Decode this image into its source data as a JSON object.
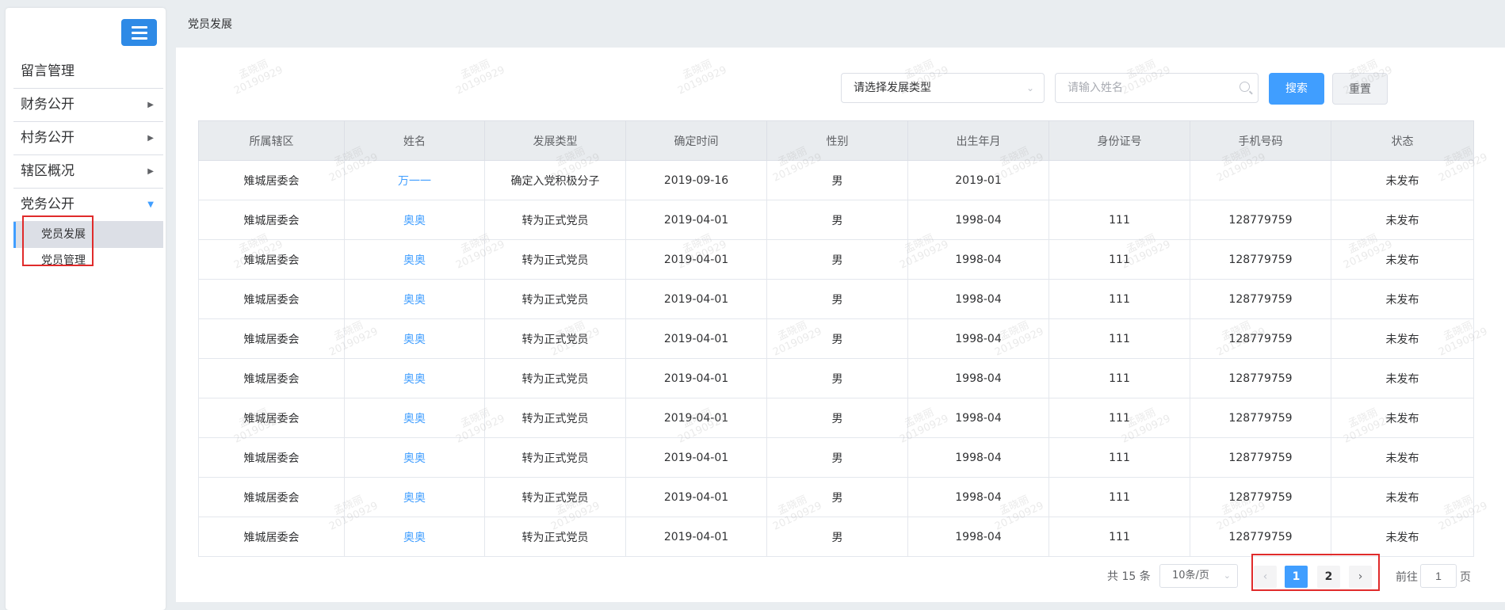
{
  "sidebar": {
    "menu": [
      {
        "label": "留言管理",
        "arrow": ""
      },
      {
        "label": "财务公开",
        "arrow": "▶"
      },
      {
        "label": "村务公开",
        "arrow": "▶"
      },
      {
        "label": "辖区概况",
        "arrow": "▶"
      },
      {
        "label": "党务公开",
        "arrow": "▼"
      }
    ],
    "submenu": [
      {
        "label": "党员发展"
      },
      {
        "label": "党员管理"
      }
    ]
  },
  "breadcrumb": "党员发展",
  "filters": {
    "type_select": "请选择发展类型",
    "name_placeholder": "请输入姓名",
    "search_label": "搜索",
    "reset_label": "重置"
  },
  "table": {
    "headers": [
      "所属辖区",
      "姓名",
      "发展类型",
      "确定时间",
      "性别",
      "出生年月",
      "身份证号",
      "手机号码",
      "状态"
    ],
    "rows": [
      [
        "雉城居委会",
        "万一一",
        "确定入党积极分子",
        "2019-09-16",
        "男",
        "2019-01",
        "",
        "",
        "未发布"
      ],
      [
        "雉城居委会",
        "奥奥",
        "转为正式党员",
        "2019-04-01",
        "男",
        "1998-04",
        "111",
        "128779759",
        "未发布"
      ],
      [
        "雉城居委会",
        "奥奥",
        "转为正式党员",
        "2019-04-01",
        "男",
        "1998-04",
        "111",
        "128779759",
        "未发布"
      ],
      [
        "雉城居委会",
        "奥奥",
        "转为正式党员",
        "2019-04-01",
        "男",
        "1998-04",
        "111",
        "128779759",
        "未发布"
      ],
      [
        "雉城居委会",
        "奥奥",
        "转为正式党员",
        "2019-04-01",
        "男",
        "1998-04",
        "111",
        "128779759",
        "未发布"
      ],
      [
        "雉城居委会",
        "奥奥",
        "转为正式党员",
        "2019-04-01",
        "男",
        "1998-04",
        "111",
        "128779759",
        "未发布"
      ],
      [
        "雉城居委会",
        "奥奥",
        "转为正式党员",
        "2019-04-01",
        "男",
        "1998-04",
        "111",
        "128779759",
        "未发布"
      ],
      [
        "雉城居委会",
        "奥奥",
        "转为正式党员",
        "2019-04-01",
        "男",
        "1998-04",
        "111",
        "128779759",
        "未发布"
      ],
      [
        "雉城居委会",
        "奥奥",
        "转为正式党员",
        "2019-04-01",
        "男",
        "1998-04",
        "111",
        "128779759",
        "未发布"
      ],
      [
        "雉城居委会",
        "奥奥",
        "转为正式党员",
        "2019-04-01",
        "男",
        "1998-04",
        "111",
        "128779759",
        "未发布"
      ]
    ]
  },
  "pagination": {
    "total": "共 15 条",
    "page_size": "10条/页",
    "prev": "‹",
    "pages": [
      "1",
      "2"
    ],
    "next": "›",
    "goto_prefix": "前往",
    "goto_value": "1",
    "goto_suffix": "页"
  },
  "watermark": {
    "line1": "孟晓丽",
    "line2": "20190929"
  },
  "colors": {
    "accent": "#409eff",
    "menu_button": "#2e8ae6",
    "highlight_box": "#e02b2b",
    "header_bg": "#e9ecef"
  }
}
